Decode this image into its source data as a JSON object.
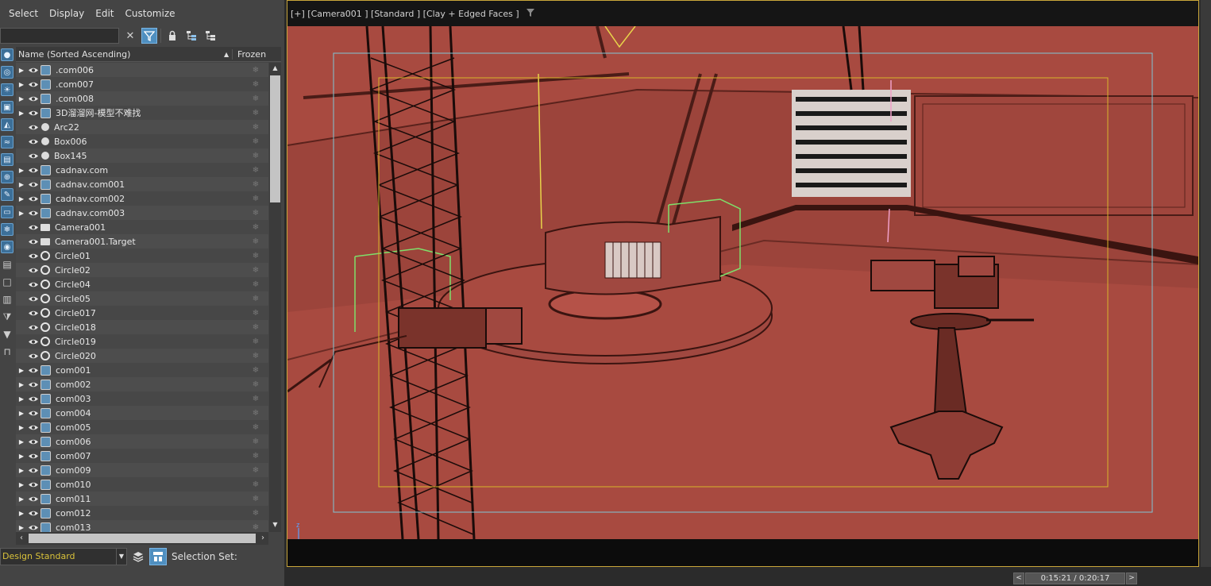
{
  "menu": [
    "Select",
    "Display",
    "Edit",
    "Customize"
  ],
  "toolbar": {
    "search_value": "",
    "clear_icon": "close-icon",
    "filter_icon": "filter-icon",
    "lock_icon": "lock-icon",
    "hierarchy_icon": "hierarchy-icon",
    "hierarchy2_icon": "hierarchy-collapse-icon"
  },
  "list": {
    "column_name": "Name (Sorted Ascending)",
    "column_frozen": "Frozen",
    "sort_indicator": "▲",
    "rows": [
      {
        "name": ".com006",
        "expandable": true,
        "icon": "group"
      },
      {
        "name": ".com007",
        "expandable": true,
        "icon": "group"
      },
      {
        "name": ".com008",
        "expandable": true,
        "icon": "group"
      },
      {
        "name": "3D溜溜网-模型不难找",
        "expandable": true,
        "icon": "group"
      },
      {
        "name": "Arc22",
        "expandable": false,
        "icon": "shape"
      },
      {
        "name": "Box006",
        "expandable": false,
        "icon": "shape"
      },
      {
        "name": "Box145",
        "expandable": false,
        "icon": "shape"
      },
      {
        "name": "cadnav.com",
        "expandable": true,
        "icon": "group"
      },
      {
        "name": "cadnav.com001",
        "expandable": true,
        "icon": "group"
      },
      {
        "name": "cadnav.com002",
        "expandable": true,
        "icon": "group"
      },
      {
        "name": "cadnav.com003",
        "expandable": true,
        "icon": "group"
      },
      {
        "name": "Camera001",
        "expandable": false,
        "icon": "camera"
      },
      {
        "name": "Camera001.Target",
        "expandable": false,
        "icon": "camera"
      },
      {
        "name": "Circle01",
        "expandable": false,
        "icon": "circle"
      },
      {
        "name": "Circle02",
        "expandable": false,
        "icon": "circle"
      },
      {
        "name": "Circle04",
        "expandable": false,
        "icon": "circle"
      },
      {
        "name": "Circle05",
        "expandable": false,
        "icon": "circle"
      },
      {
        "name": "Circle017",
        "expandable": false,
        "icon": "circle"
      },
      {
        "name": "Circle018",
        "expandable": false,
        "icon": "circle"
      },
      {
        "name": "Circle019",
        "expandable": false,
        "icon": "circle"
      },
      {
        "name": "Circle020",
        "expandable": false,
        "icon": "circle"
      },
      {
        "name": "com001",
        "expandable": true,
        "icon": "group"
      },
      {
        "name": "com002",
        "expandable": true,
        "icon": "group"
      },
      {
        "name": "com003",
        "expandable": true,
        "icon": "group"
      },
      {
        "name": "com004",
        "expandable": true,
        "icon": "group"
      },
      {
        "name": "com005",
        "expandable": true,
        "icon": "group"
      },
      {
        "name": "com006",
        "expandable": true,
        "icon": "group"
      },
      {
        "name": "com007",
        "expandable": true,
        "icon": "group"
      },
      {
        "name": "com009",
        "expandable": true,
        "icon": "group"
      },
      {
        "name": "com010",
        "expandable": true,
        "icon": "group"
      },
      {
        "name": "com011",
        "expandable": true,
        "icon": "group"
      },
      {
        "name": "com012",
        "expandable": true,
        "icon": "group"
      },
      {
        "name": "com013",
        "expandable": true,
        "icon": "group"
      }
    ]
  },
  "bottom": {
    "layer": "Design Standard",
    "selection_set_label": "Selection Set:"
  },
  "viewport": {
    "label": "[+] [Camera001 ] [Standard ] [Clay + Edged Faces ]",
    "background_color": "#a84a40"
  },
  "timeline": {
    "time": "0:15:21 / 0:20:17",
    "prev": "<",
    "next": ">"
  },
  "colors": {
    "accent": "#4f8fc0",
    "viewport_border": "#c9a63a",
    "layer_text": "#d9c23a"
  }
}
